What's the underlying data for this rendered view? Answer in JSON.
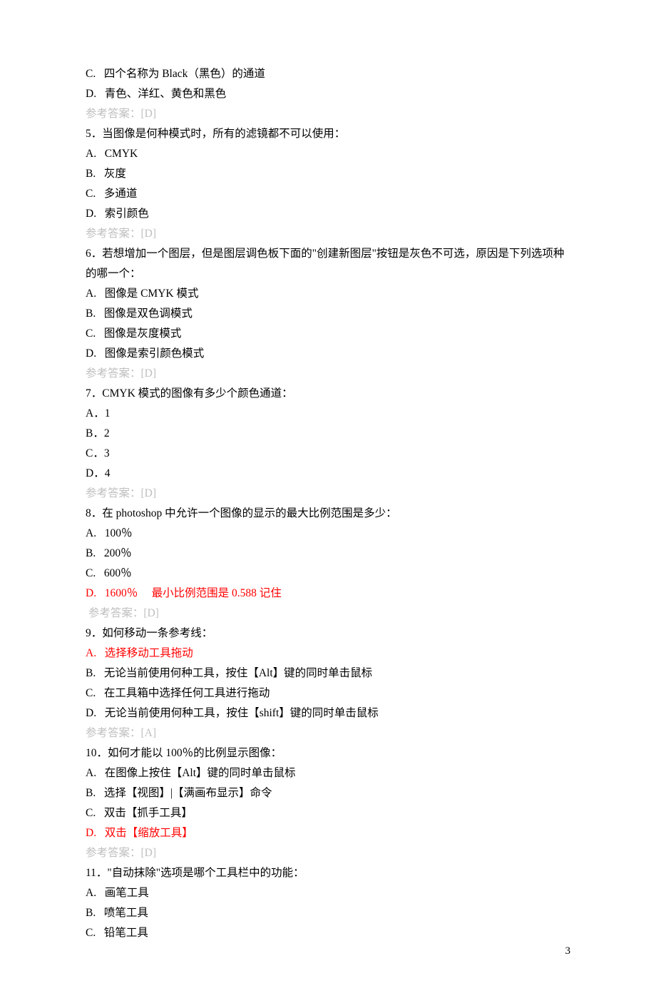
{
  "pageNumber": "3",
  "lines": [
    {
      "cls": "line",
      "text": "C.   四个名称为 Black（黑色）的通道"
    },
    {
      "cls": "line",
      "text": "D.   青色、洋红、黄色和黑色"
    },
    {
      "cls": "line answer",
      "text": "参考答案：[D]"
    },
    {
      "cls": "line",
      "text": "5．当图像是何种模式时，所有的滤镜都不可以使用："
    },
    {
      "cls": "line",
      "text": "A.   CMYK"
    },
    {
      "cls": "line",
      "text": "B.   灰度"
    },
    {
      "cls": "line",
      "text": "C.   多通道"
    },
    {
      "cls": "line",
      "text": "D.   索引颜色"
    },
    {
      "cls": "line answer",
      "text": "参考答案：[D]"
    },
    {
      "cls": "line",
      "text": "6．若想增加一个图层，但是图层调色板下面的\"创建新图层\"按钮是灰色不可选，原因是下列选项种的哪一个："
    },
    {
      "cls": "line",
      "text": "A.   图像是 CMYK 模式"
    },
    {
      "cls": "line",
      "text": "B.   图像是双色调模式"
    },
    {
      "cls": "line",
      "text": "C.   图像是灰度模式"
    },
    {
      "cls": "line",
      "text": "D.   图像是索引颜色模式"
    },
    {
      "cls": "line answer",
      "text": "参考答案：[D]"
    },
    {
      "cls": "line",
      "text": "7．CMYK 模式的图像有多少个颜色通道："
    },
    {
      "cls": "line",
      "text": "A．1"
    },
    {
      "cls": "line",
      "text": "B．2"
    },
    {
      "cls": "line",
      "text": "C．3"
    },
    {
      "cls": "line",
      "text": "D．4"
    },
    {
      "cls": "line answer",
      "text": "参考答案：[D]"
    },
    {
      "cls": "line",
      "text": "8．在 photoshop 中允许一个图像的显示的最大比例范围是多少："
    },
    {
      "cls": "line",
      "text": "A.   100％"
    },
    {
      "cls": "line",
      "text": "B.   200％"
    },
    {
      "cls": "line",
      "text": "C.   600％"
    },
    {
      "cls": "line red",
      "text": "D.   1600％     最小比例范围是 0.588 记住"
    },
    {
      "cls": "line answer",
      "text": " 参考答案：[D]"
    },
    {
      "cls": "line",
      "text": "9．如何移动一条参考线："
    },
    {
      "cls": "line red",
      "text": "A.   选择移动工具拖动"
    },
    {
      "cls": "line",
      "text": "B.   无论当前使用何种工具，按住【Alt】键的同时单击鼠标"
    },
    {
      "cls": "line",
      "text": "C.   在工具箱中选择任何工具进行拖动"
    },
    {
      "cls": "line",
      "text": "D.   无论当前使用何种工具，按住【shift】键的同时单击鼠标"
    },
    {
      "cls": "line answer",
      "text": "参考答案：[A]"
    },
    {
      "cls": "line",
      "text": "10．如何才能以 100％的比例显示图像："
    },
    {
      "cls": "line",
      "text": "A.   在图像上按住【Alt】键的同时单击鼠标"
    },
    {
      "cls": "line",
      "text": "B.   选择【视图】|【满画布显示】命令"
    },
    {
      "cls": "line",
      "text": "C.   双击【抓手工具】"
    },
    {
      "cls": "line red",
      "text": "D.   双击【缩放工具】"
    },
    {
      "cls": "line answer",
      "text": "参考答案：[D]"
    },
    {
      "cls": "line",
      "text": "11．\"自动抹除\"选项是哪个工具栏中的功能："
    },
    {
      "cls": "line",
      "text": "A.   画笔工具"
    },
    {
      "cls": "line",
      "text": "B.   喷笔工具"
    },
    {
      "cls": "line",
      "text": "C.   铅笔工具"
    }
  ]
}
